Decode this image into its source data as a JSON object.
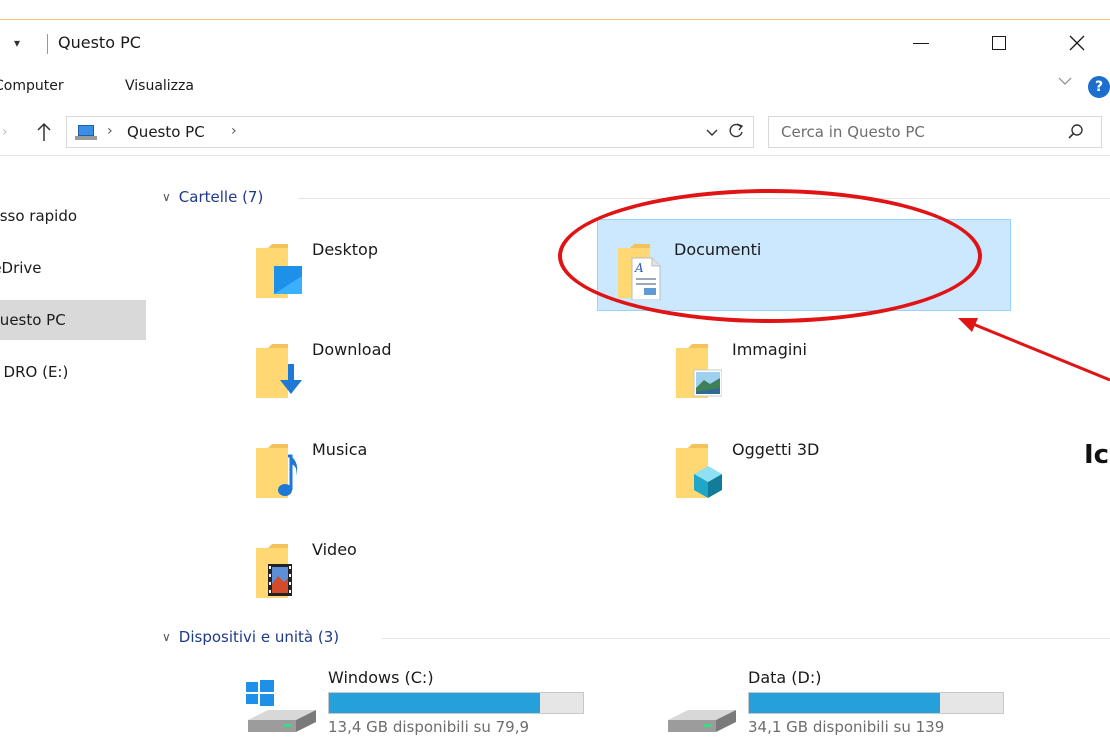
{
  "window": {
    "title": "Questo PC",
    "quick_access_arrow": "▾"
  },
  "ribbon": {
    "tabs": [
      {
        "label": "Computer"
      },
      {
        "label": "Visualizza"
      }
    ],
    "help_label": "?"
  },
  "address": {
    "location": "Questo PC",
    "search_placeholder": "Cerca in Questo PC"
  },
  "nav": {
    "items": [
      {
        "label": "Accesso rapido"
      },
      {
        "label": "OneDrive"
      },
      {
        "label": "Questo PC",
        "selected": true
      },
      {
        "label": "USB DRO (E:)"
      }
    ]
  },
  "folders_section": {
    "header": "Cartelle (7)",
    "items": [
      {
        "label": "Desktop",
        "icon": "desktop-folder-icon"
      },
      {
        "label": "Documenti",
        "icon": "documents-folder-icon",
        "selected": true
      },
      {
        "label": "Download",
        "icon": "downloads-folder-icon"
      },
      {
        "label": "Immagini",
        "icon": "pictures-folder-icon"
      },
      {
        "label": "Musica",
        "icon": "music-folder-icon"
      },
      {
        "label": "Oggetti 3D",
        "icon": "3d-objects-folder-icon"
      },
      {
        "label": "Video",
        "icon": "videos-folder-icon"
      }
    ]
  },
  "devices_section": {
    "header": "Dispositivi e unità (3)",
    "items": [
      {
        "label": "Windows (C:)",
        "info": "13,4 GB disponibili su 79,9",
        "used_fraction": 0.83
      },
      {
        "label": "Data (D:)",
        "info": "34,1 GB disponibili su 139",
        "used_fraction": 0.75
      }
    ]
  },
  "annotation": {
    "text": "Icona",
    "color": "#e01414"
  },
  "colors": {
    "selection_bg": "#cce8ff",
    "selection_border": "#99d1ff",
    "drive_fill": "#26a0da",
    "section_header": "#1e3a8a"
  }
}
